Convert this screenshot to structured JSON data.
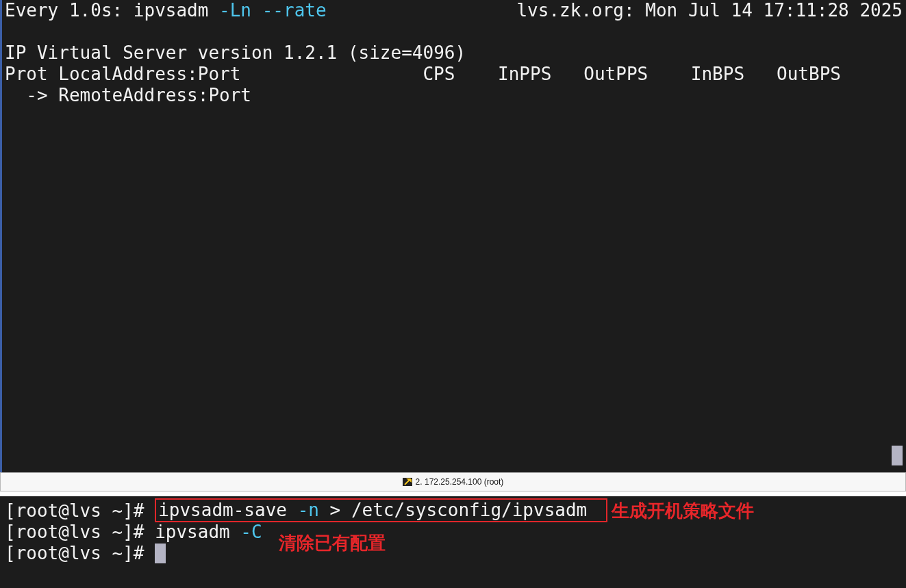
{
  "top_pane": {
    "status_line": {
      "command": [
        {
          "kind": "plain",
          "text": "Every 1.0s: ipvsadm"
        },
        {
          "kind": "option",
          "text": "-Ln --rate"
        }
      ],
      "host_time": "lvs.zk.org: Mon Jul 14 17:11:28 2025"
    },
    "version_line": "IP Virtual Server version 1.2.1 (size=4096)",
    "columns": [
      "Prot LocalAddress:Port",
      "CPS",
      "InPPS",
      "OutPPS",
      "InBPS",
      "OutBPS"
    ],
    "sub_header": "-> RemoteAddress:Port"
  },
  "tab": {
    "title": "2. 172.25.254.100 (root)"
  },
  "bottom_pane": {
    "lines": [
      {
        "prompt": "[root@lvs ~]#",
        "command": [
          {
            "kind": "plain",
            "text": "ipvsadm-save"
          },
          {
            "kind": "option",
            "text": "-n"
          },
          {
            "kind": "plain",
            "text": "> /etc/sysconfig/ipvsadm"
          }
        ],
        "boxed": true,
        "note": "生成开机策略文件"
      },
      {
        "prompt": "[root@lvs ~]#",
        "command": [
          {
            "kind": "plain",
            "text": "ipvsadm"
          },
          {
            "kind": "option",
            "text": "-C"
          }
        ],
        "boxed": false,
        "note_below": "清除已有配置"
      },
      {
        "prompt": "[root@lvs ~]#",
        "boxed": false,
        "cursor": true
      }
    ]
  }
}
